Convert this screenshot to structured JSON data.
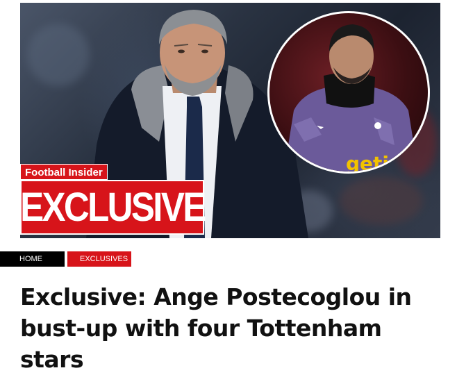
{
  "hero": {
    "badge_top": "Football Insider",
    "badge_main": "EXCLUSIVE",
    "inset_shirt_text": "geti"
  },
  "breadcrumb": {
    "items": [
      {
        "label": "HOME"
      },
      {
        "label": "EXCLUSIVES"
      }
    ]
  },
  "article": {
    "title": "Exclusive: Ange Postecoglou in bust-up with four Tottenham stars"
  },
  "colors": {
    "brand_red": "#d7141a",
    "crumb_home_bg": "#000000"
  }
}
